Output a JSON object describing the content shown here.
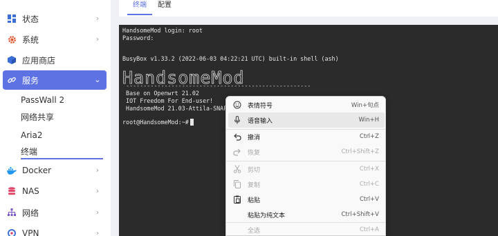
{
  "sidebar": {
    "items": [
      {
        "label": "状态",
        "icon": "dashboard-icon"
      },
      {
        "label": "系统",
        "icon": "gear-icon"
      },
      {
        "label": "应用商店",
        "icon": "cube-icon"
      },
      {
        "label": "服务",
        "icon": "link-icon"
      },
      {
        "label": "Docker",
        "icon": "docker-icon"
      },
      {
        "label": "NAS",
        "icon": "database-icon"
      },
      {
        "label": "网络",
        "icon": "network-icon"
      },
      {
        "label": "VPN",
        "icon": "vpn-icon"
      }
    ],
    "sub_items": [
      "PassWall 2",
      "网络共享",
      "Aria2",
      "终端"
    ]
  },
  "tabs": [
    "终端",
    "配置"
  ],
  "terminal": {
    "lines": [
      "HandsomeMod login: root",
      "Password:",
      "BusyBox v1.33.2 (2022-06-03 04:22:21 UTC) built-in shell (ash)",
      "HandsomeMod",
      " -----------------------------------------------------",
      " Base on Openwrt 21.02",
      " IOT Freedom For End-user!",
      " HandsomeMod 21.03-Attila-SNAPSHOT",
      "root@HandsomeMod:~#"
    ]
  },
  "context_menu": {
    "items": [
      {
        "label": "表情符号",
        "shortcut": "Win+句点",
        "icon": "emoji-icon",
        "disabled": false
      },
      {
        "label": "语音输入",
        "shortcut": "Win+H",
        "icon": "microphone-icon",
        "disabled": false
      },
      {
        "label": "撤消",
        "shortcut": "Ctrl+Z",
        "icon": "undo-icon",
        "disabled": false
      },
      {
        "label": "恢复",
        "shortcut": "Ctrl+Shift+Z",
        "icon": "redo-icon",
        "disabled": true
      },
      {
        "label": "剪切",
        "shortcut": "Ctrl+X",
        "icon": "scissors-icon",
        "disabled": true
      },
      {
        "label": "复制",
        "shortcut": "Ctrl+C",
        "icon": "copy-icon",
        "disabled": true
      },
      {
        "label": "粘贴",
        "shortcut": "Ctrl+V",
        "icon": "paste-icon",
        "disabled": false
      },
      {
        "label": "粘贴为纯文本",
        "shortcut": "Ctrl+Shift+V",
        "icon": "",
        "disabled": false
      },
      {
        "label": "全选",
        "shortcut": "Ctrl+A",
        "icon": "",
        "disabled": true
      }
    ]
  },
  "colors": {
    "accent": "#5e72e4",
    "terminal_bg": "#2b2b2b"
  }
}
